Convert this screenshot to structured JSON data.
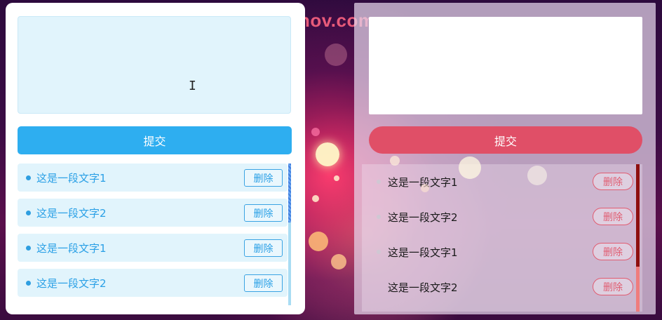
{
  "background": {
    "watermark_text": "nov.com",
    "accent_colors": {
      "left": "#2eaef0",
      "right": "#e04f67"
    }
  },
  "left_panel": {
    "submit_label": "提交",
    "delete_label": "删除",
    "items": [
      {
        "text": "这是一段文字1"
      },
      {
        "text": "这是一段文字2"
      },
      {
        "text": "这是一段文字1"
      },
      {
        "text": "这是一段文字2"
      }
    ]
  },
  "right_panel": {
    "submit_label": "提交",
    "delete_label": "删除",
    "items": [
      {
        "text": "这是一段文字1"
      },
      {
        "text": "这是一段文字2"
      },
      {
        "text": "这是一段文字1"
      },
      {
        "text": "这是一段文字2"
      }
    ]
  },
  "icons": {
    "text_cursor": "I-beam-cursor-icon"
  }
}
